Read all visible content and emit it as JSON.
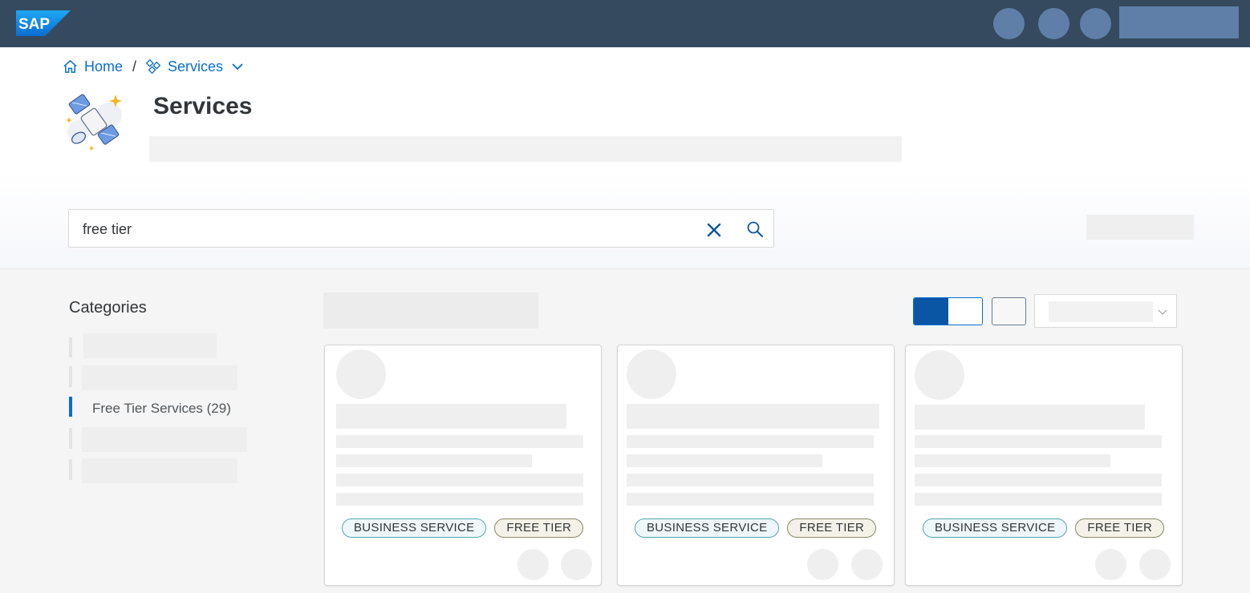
{
  "shell": {
    "logo_text": "SAP",
    "colors": {
      "shellbar": "#354a5f",
      "placeholder": "#5f7fa8"
    }
  },
  "breadcrumb": {
    "home_label": "Home",
    "separator": "/",
    "current_label": "Services"
  },
  "header": {
    "title": "Services"
  },
  "search": {
    "value": "free tier",
    "placeholder": "",
    "clear_icon": "close-icon",
    "search_icon": "search-icon"
  },
  "sidebar": {
    "title": "Categories",
    "active_item_label": "Free Tier Services (29)"
  },
  "cards": [
    {
      "tags": [
        "BUSINESS SERVICE",
        "FREE TIER"
      ]
    },
    {
      "tags": [
        "BUSINESS SERVICE",
        "FREE TIER"
      ]
    },
    {
      "tags": [
        "BUSINESS SERVICE",
        "FREE TIER"
      ]
    }
  ],
  "colors": {
    "accent": "#0a6ed1",
    "business_tag_border": "#52a6b4",
    "free_tier_tag_border": "#8a8766"
  }
}
